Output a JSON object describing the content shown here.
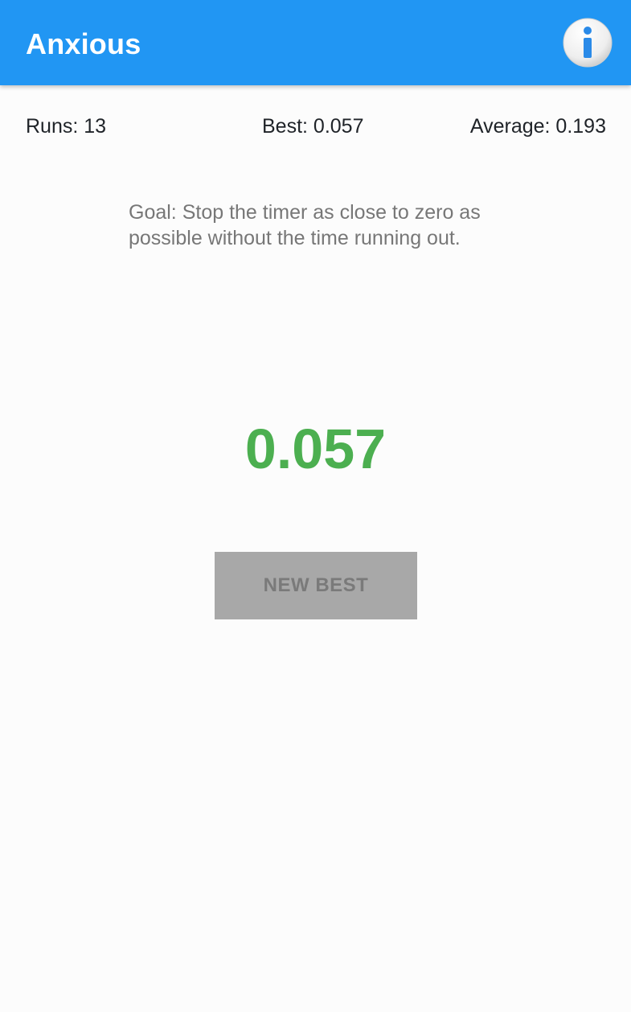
{
  "app_bar": {
    "title": "Anxious",
    "info_icon": "info-icon",
    "color": "#2196f3"
  },
  "stats": {
    "runs": "Runs: 13",
    "best": "Best: 0.057",
    "average": "Average: 0.193"
  },
  "goal_text": "Goal: Stop the timer as close to zero as possible without the time running out.",
  "timer": {
    "value": "0.057",
    "color": "#4caf50"
  },
  "action_button": {
    "label": "NEW BEST"
  }
}
